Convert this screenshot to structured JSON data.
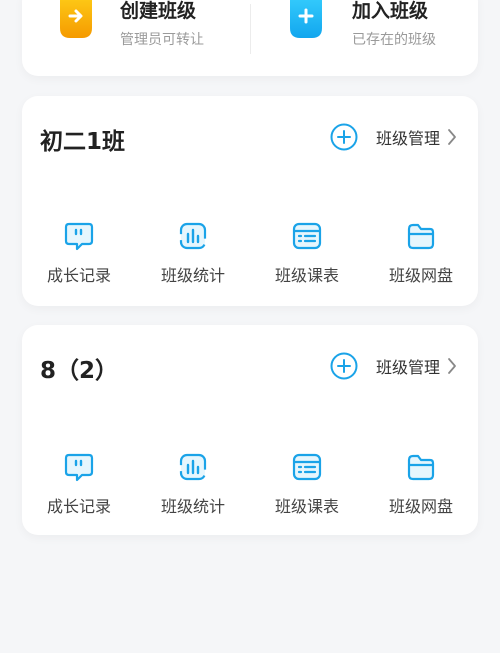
{
  "top_actions": {
    "create": {
      "title": "创建班级",
      "subtitle": "管理员可转让"
    },
    "join": {
      "title": "加入班级",
      "subtitle": "已存在的班级"
    }
  },
  "classes": [
    {
      "name": "初二1班",
      "manage_label": "班级管理",
      "tools": [
        {
          "label": "成长记录",
          "icon": "chat-quote-icon"
        },
        {
          "label": "班级统计",
          "icon": "bar-chart-icon"
        },
        {
          "label": "班级课表",
          "icon": "schedule-icon"
        },
        {
          "label": "班级网盘",
          "icon": "folder-icon"
        }
      ]
    },
    {
      "name": "8（2）",
      "manage_label": "班级管理",
      "tools": [
        {
          "label": "成长记录",
          "icon": "chat-quote-icon"
        },
        {
          "label": "班级统计",
          "icon": "bar-chart-icon"
        },
        {
          "label": "班级课表",
          "icon": "schedule-icon"
        },
        {
          "label": "班级网盘",
          "icon": "folder-icon"
        }
      ]
    }
  ],
  "colors": {
    "accent_blue": "#1aa3e8",
    "create_orange": "#f7a600",
    "join_blue": "#1fb6f0"
  }
}
